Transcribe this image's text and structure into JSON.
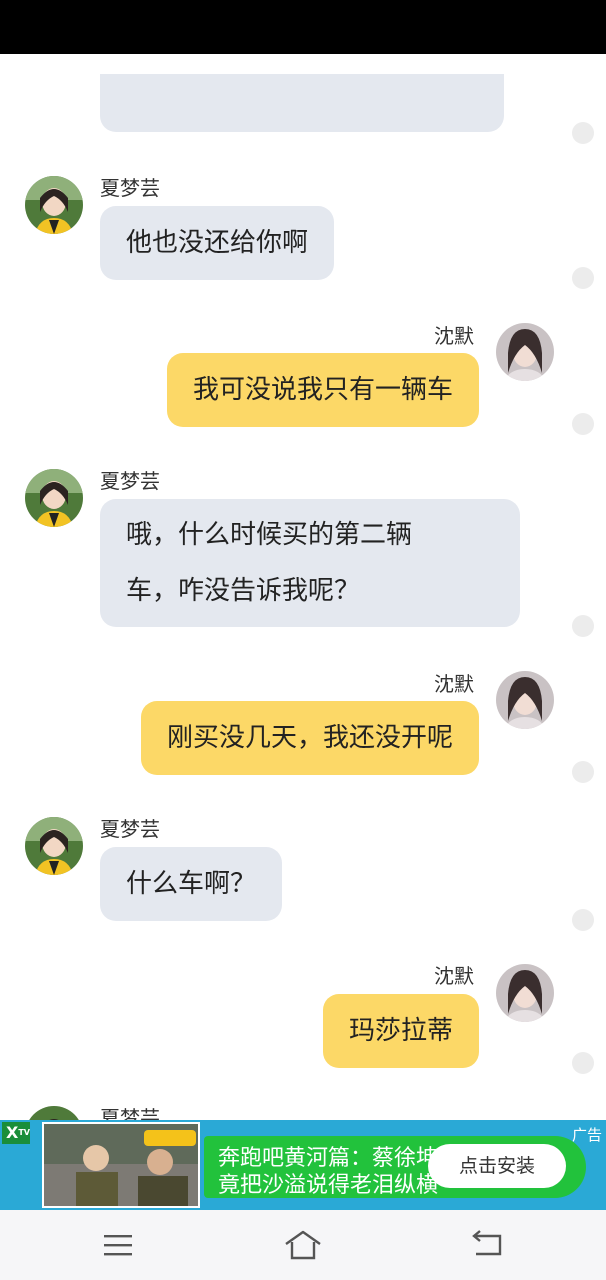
{
  "contacts": {
    "other_name": "夏梦芸",
    "me_name": "沈默"
  },
  "messages": [
    {
      "sender": "other",
      "text": "他也没还给你啊"
    },
    {
      "sender": "me",
      "text": "我可没说我只有一辆车"
    },
    {
      "sender": "other",
      "lines": [
        "哦，什么时候买的第二辆",
        "车，咋没告诉我呢？"
      ]
    },
    {
      "sender": "me",
      "text": "刚买没几天，我还没开呢"
    },
    {
      "sender": "other",
      "text": "什么车啊？"
    },
    {
      "sender": "me",
      "text": "玛莎拉蒂"
    }
  ],
  "ad": {
    "line1": "奔跑吧黄河篇：蔡徐坤",
    "line2": "竟把沙溢说得老泪纵横",
    "install_button": "点击安装",
    "tag": "广告",
    "close_label": "X",
    "brand_badge": "TV"
  },
  "colors": {
    "incoming_bubble": "#e4e8ef",
    "outgoing_bubble": "#fcd867",
    "ad_background": "#2aa9d6",
    "ad_text_panel": "#22c23c",
    "install_button_bg": "#ffffff"
  },
  "nav": {
    "menu_icon": "menu-icon",
    "home_icon": "home-icon",
    "back_icon": "back-icon"
  }
}
